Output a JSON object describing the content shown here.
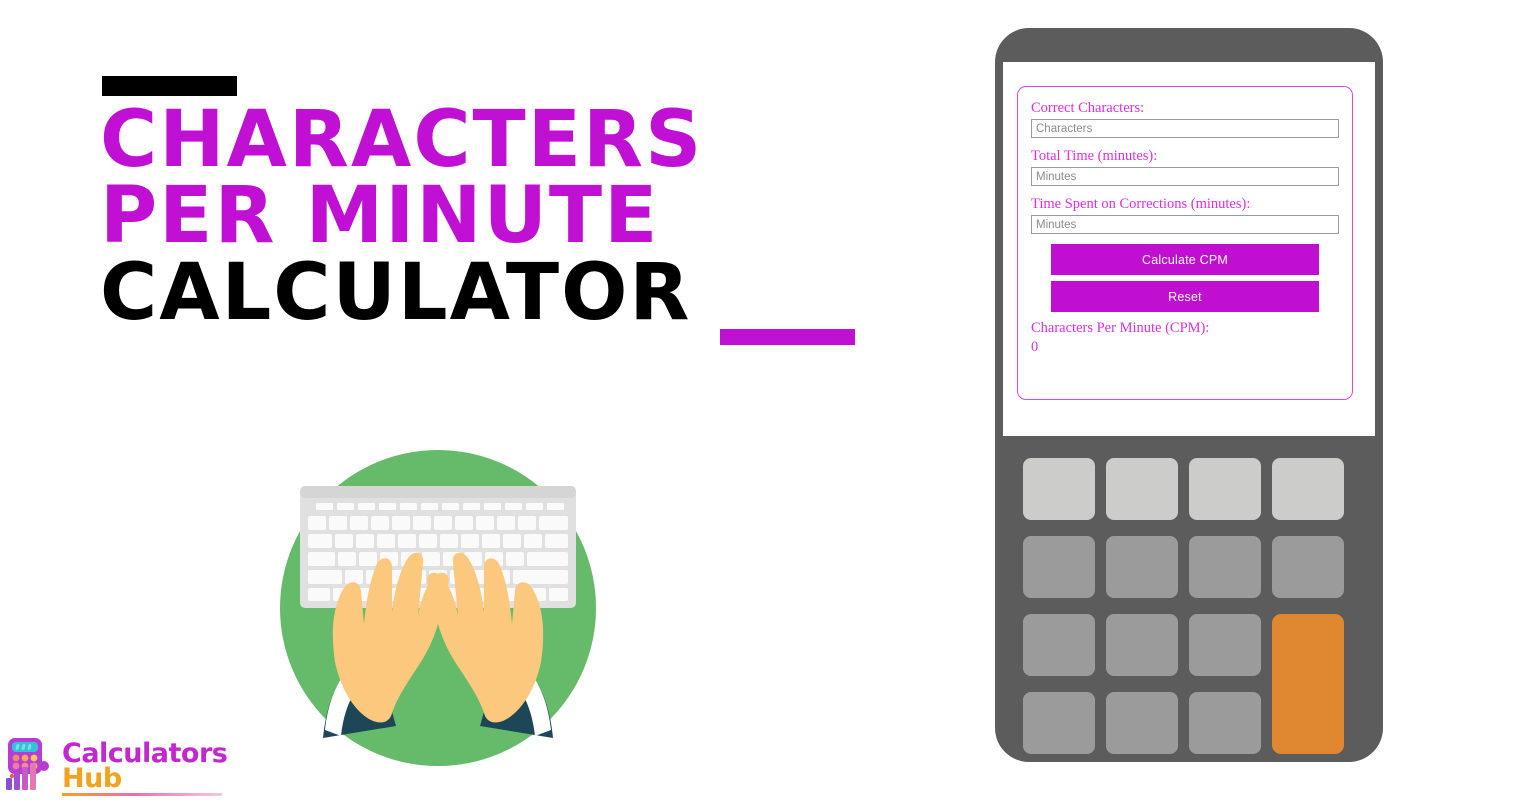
{
  "page": {
    "title_lines": [
      "CHARACTERS",
      "PER MINUTE",
      "CALCULATOR"
    ],
    "accent_color": "#bf10d4",
    "black_color": "#000000"
  },
  "logo": {
    "line1": "Calculators",
    "line2": "Hub",
    "line1_color": "#c327cf",
    "line2_color": "#f2a31e",
    "mark_name": "calculator-bar-chart-logo"
  },
  "illustration": {
    "name": "hands-typing-on-keyboard",
    "circle_color": "#66bb6a",
    "keyboard_color": "#e6e6e6",
    "skin_color": "#fbc87d",
    "sleeve_color": "#1d4757"
  },
  "calculator": {
    "body_color": "#5c5c5c",
    "screen_color": "#ffffff",
    "panel_border_color": "#d94ae0",
    "fields": [
      {
        "label": "Correct Characters:",
        "placeholder": "Characters",
        "value": ""
      },
      {
        "label": "Total Time (minutes):",
        "placeholder": "Minutes",
        "value": ""
      },
      {
        "label": "Time Spent on Corrections (minutes):",
        "placeholder": "Minutes",
        "value": ""
      }
    ],
    "buttons": [
      {
        "label": "Calculate CPM",
        "color": "#c10fd1"
      },
      {
        "label": "Reset",
        "color": "#c10fd1"
      }
    ],
    "result": {
      "label": "Characters Per Minute (CPM):",
      "value": "0"
    },
    "keypad": {
      "rows": 4,
      "cols": 4,
      "light_key_color": "#ccccca",
      "key_color": "#9b9b9b",
      "accent_key_color": "#e08830"
    }
  }
}
